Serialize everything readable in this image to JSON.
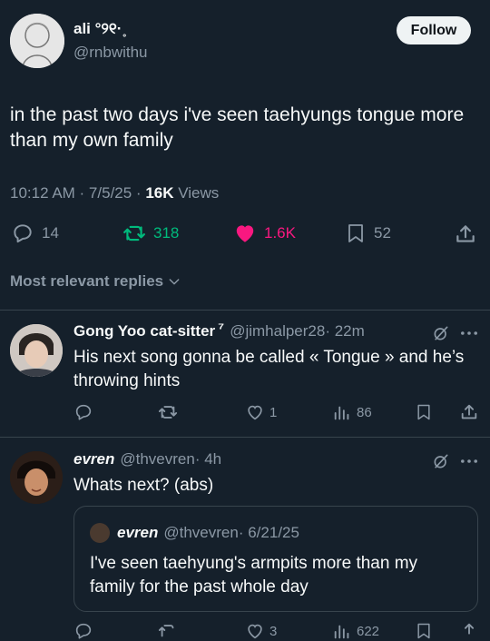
{
  "colors": {
    "background": "#15202b",
    "text": "#f7f9f9",
    "muted": "#8b98a5",
    "retweet": "#00ba7c",
    "like": "#f91880",
    "divider": "#38444d"
  },
  "post": {
    "display_name": "ali °୨୧·˳",
    "handle": "@rnbwithu",
    "follow_label": "Follow",
    "text": "in the past two days i've seen taehyungs tongue more than my own family",
    "time": "10:12 AM · 7/5/25 · ",
    "views_count": "16K",
    "views_label": " Views",
    "replies": "14",
    "reposts": "318",
    "likes": "1.6K",
    "bookmarks": "52"
  },
  "replies_filter": {
    "label": "Most relevant replies"
  },
  "replies": [
    {
      "display_name": "Gong Yoo cat-sitter",
      "badge": "⁷",
      "handle": "@jimhalper28",
      "time": " · 22m",
      "text": "His next song gonna be called « Tongue » and he’s throwing hints",
      "likes": "1",
      "views": "86"
    },
    {
      "display_name": "evren",
      "handle": "@thvevren",
      "time": " · 4h",
      "text": "Whats next? (abs)",
      "quote": {
        "display_name": "evren",
        "handle": "@thvevren",
        "time": " · 6/21/25",
        "text": "I've seen taehyung's armpits more than my family for the past whole day"
      },
      "likes": "3",
      "views": "622"
    }
  ]
}
